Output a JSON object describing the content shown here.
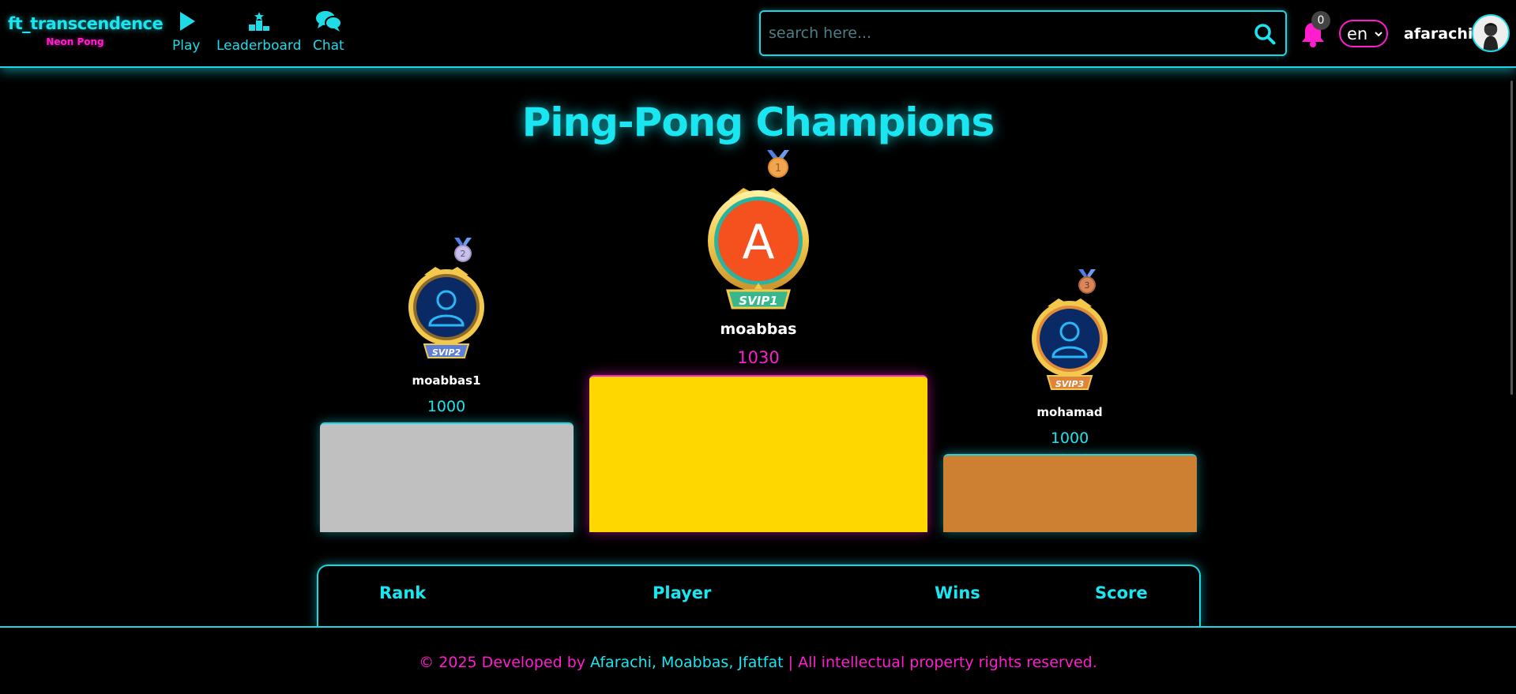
{
  "brand": {
    "title": "ft_transcendence",
    "subtitle": "Neon Pong"
  },
  "nav": [
    {
      "label": "Play",
      "icon": "play-icon"
    },
    {
      "label": "Leaderboard",
      "icon": "podium-icon"
    },
    {
      "label": "Chat",
      "icon": "chat-icon"
    }
  ],
  "search": {
    "placeholder": "search here...",
    "value": ""
  },
  "notifications": {
    "count": "0"
  },
  "language": {
    "selected": "en"
  },
  "user": {
    "name": "afarachi"
  },
  "page": {
    "title": "Ping-Pong Champions"
  },
  "podium": {
    "first": {
      "rank": "1",
      "name": "moabbas",
      "score": "1030",
      "avatar_letter": "A",
      "badge": "SVIP1"
    },
    "second": {
      "rank": "2",
      "name": "moabbas1",
      "score": "1000",
      "badge": "SVIP2"
    },
    "third": {
      "rank": "3",
      "name": "mohamad",
      "score": "1000",
      "badge": "SVIP3"
    }
  },
  "table": {
    "headers": [
      "Rank",
      "Player",
      "Wins",
      "Score"
    ]
  },
  "footer": {
    "prefix": "© 2025 Developed by",
    "developers": "Afarachi, Moabbas, Jfatfat",
    "suffix": "| All intellectual property rights reserved."
  },
  "colors": {
    "cyan": "#19e6f0",
    "magenta": "#ff1dce",
    "gold": "#ffd700",
    "silver": "#c0c0c0",
    "bronze": "#cd7f32",
    "avatar_orange": "#f4511e"
  }
}
